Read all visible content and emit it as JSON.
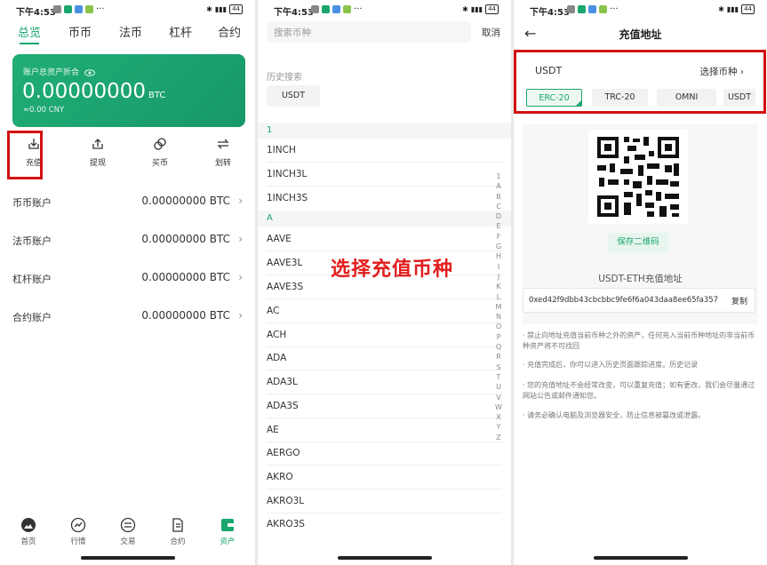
{
  "status": {
    "time": "下午4:53",
    "dots": "···",
    "battery": "44"
  },
  "screen1": {
    "tabs": [
      "总览",
      "币币",
      "法币",
      "杠杆",
      "合约"
    ],
    "asset_label": "账户总资产折合",
    "asset_amount": "0.00000000",
    "asset_unit": "BTC",
    "asset_cny": "≈0.00 CNY",
    "actions": [
      "充值",
      "提现",
      "买币",
      "划转"
    ],
    "accounts": [
      {
        "name": "币币账户",
        "value": "0.00000000 BTC"
      },
      {
        "name": "法币账户",
        "value": "0.00000000 BTC"
      },
      {
        "name": "杠杆账户",
        "value": "0.00000000 BTC"
      },
      {
        "name": "合约账户",
        "value": "0.00000000 BTC"
      }
    ],
    "chevron": "›",
    "nav": [
      "首页",
      "行情",
      "交易",
      "合约",
      "资产"
    ]
  },
  "screen2": {
    "search_placeholder": "搜索币种",
    "cancel": "取消",
    "history_title": "历史搜索",
    "history_chip": "USDT",
    "section_1": "1",
    "coins_1": [
      "1INCH",
      "1INCH3L",
      "1INCH3S"
    ],
    "section_a": "A",
    "coins_a": [
      "AAVE",
      "AAVE3L",
      "AAVE3S",
      "AC",
      "ACH",
      "ADA",
      "ADA3L",
      "ADA3S",
      "AE",
      "AERGO",
      "AKRO",
      "AKRO3L",
      "AKRO3S"
    ],
    "index_letters": [
      "1",
      "A",
      "B",
      "C",
      "D",
      "E",
      "F",
      "G",
      "H",
      "I",
      "J",
      "K",
      "L",
      "M",
      "N",
      "O",
      "P",
      "Q",
      "R",
      "S",
      "T",
      "U",
      "V",
      "W",
      "X",
      "Y",
      "Z"
    ],
    "overlay_text": "选择充值币种"
  },
  "screen3": {
    "title": "充值地址",
    "back_icon": "←",
    "coin": "USDT",
    "select_coin": "选择币种",
    "chains": [
      "ERC-20",
      "TRC-20",
      "OMNI",
      "USDT"
    ],
    "save_qr": "保存二维码",
    "address_title": "USDT-ETH充值地址",
    "address": "0xed42f9dbb43cbcbbc9fe6f6a043daa8ee65fa357",
    "copy": "复制",
    "notes": [
      "· 禁止向地址充值当前币种之外的资产，任何充入当前币种地址的非当前币种资产将不可找回",
      "· 充值完成后，你可以进入历史页面跟踪进度。历史记录",
      "· 您的充值地址不会经常改变，可以重复充值；如有更改，我们会尽量通过网站公告或邮件通知您。",
      "· 请务必确认电脑及浏览器安全，防止信息被篡改或泄露。"
    ]
  },
  "colors": {
    "accent": "#1aa66d",
    "highlight": "#d21010"
  }
}
